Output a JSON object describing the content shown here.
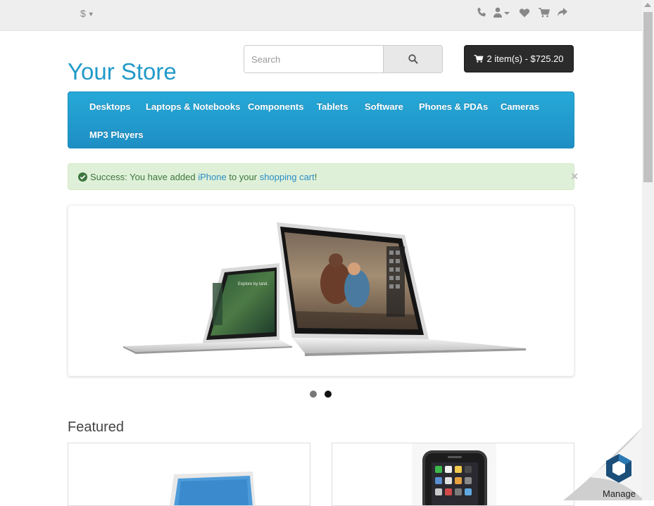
{
  "topbar": {
    "currency_symbol": "$",
    "icons": [
      "phone-icon",
      "user-icon",
      "heart-icon",
      "cart-icon",
      "share-icon"
    ]
  },
  "header": {
    "logo": "Your Store",
    "search": {
      "placeholder": "Search"
    },
    "cart_label": "2 item(s) - $725.20"
  },
  "menu": {
    "items": [
      "Desktops",
      "Laptops & Notebooks",
      "Components",
      "Tablets",
      "Software",
      "Phones & PDAs",
      "Cameras",
      "MP3 Players"
    ]
  },
  "alert": {
    "prefix": "Success: You have added ",
    "product": "iPhone",
    "middle": " to your ",
    "cart_link": "shopping cart",
    "suffix": "!",
    "close": "×"
  },
  "slideshow": {
    "screen_small_text": "Explore by land.",
    "brand": "MacBook Air",
    "active_index": 2,
    "count": 2
  },
  "featured": {
    "heading": "Featured"
  },
  "manage": {
    "label": "Manage"
  },
  "colors": {
    "accent": "#229ac8",
    "menu": "#229ac8",
    "success_bg": "#dff0d8",
    "success_text": "#3c763d"
  }
}
